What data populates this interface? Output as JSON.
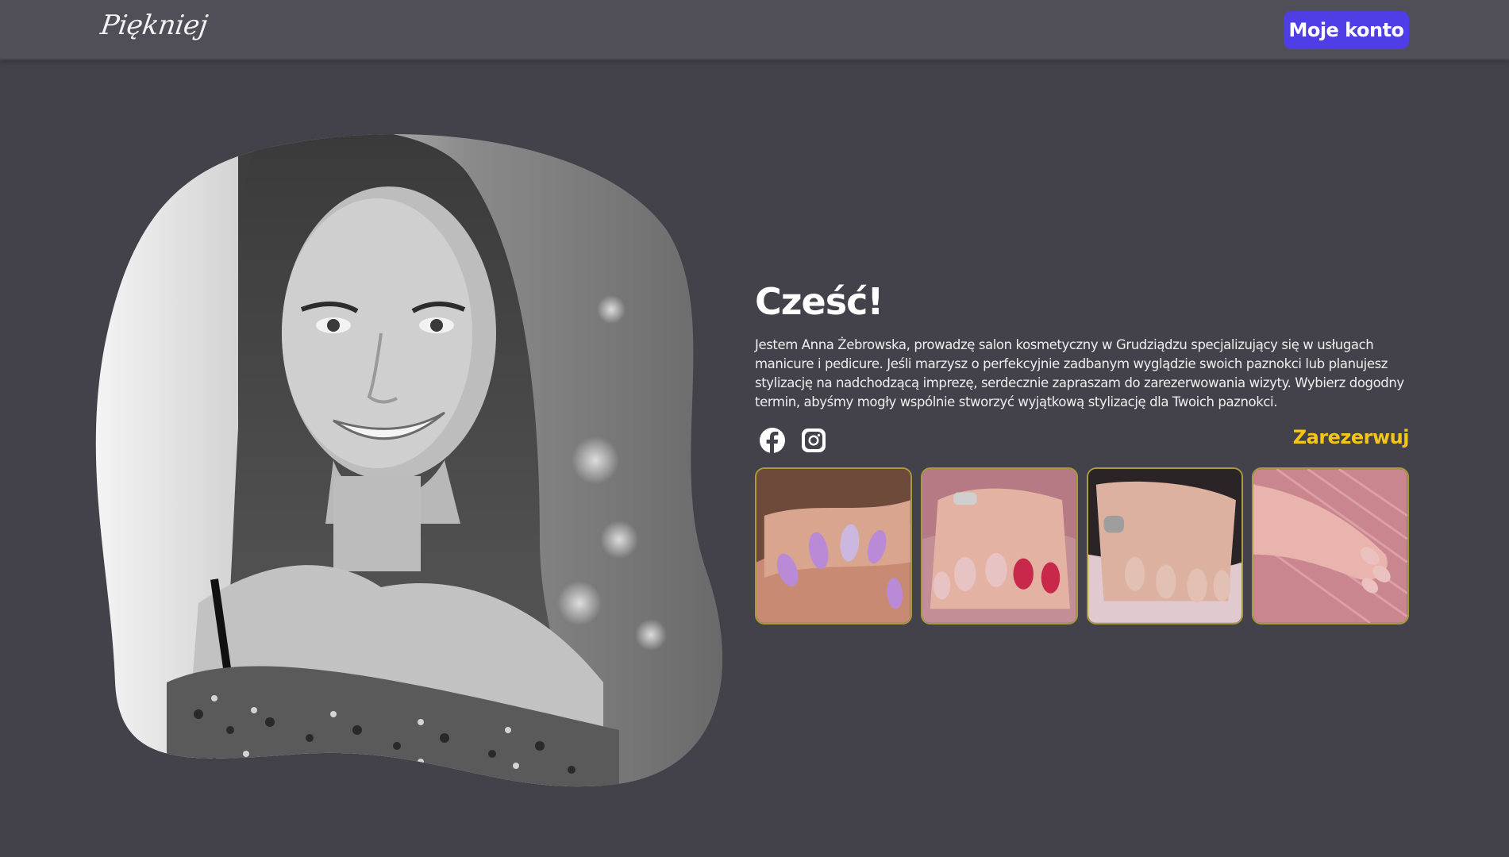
{
  "navbar": {
    "logo": "Piękniej",
    "account_button": "Moje konto"
  },
  "hero": {
    "portrait_alt": "Anna Żebrowska",
    "greeting": "Cześć!",
    "bio": "Jestem Anna Żebrowska, prowadzę salon kosmetyczny w Grudziądzu specjalizujący się w usługach manicure i pedicure. Jeśli marzysz o perfekcyjnie zadbanym wyglądzie swoich paznokci lub planujesz stylizację na nadchodzącą imprezę, serdecznie zapraszam do zarezerwowania wizyty. Wybierz dogodny termin, abyśmy mogły wspólnie stworzyć wyjątkową stylizację dla Twoich paznokci.",
    "reserve_link": "Zarezerwuj"
  },
  "social": {
    "icons": [
      "facebook-icon",
      "instagram-icon"
    ]
  },
  "gallery": {
    "items": [
      {
        "name": "lilac-nails-photo",
        "nail_color": "#b98ad6",
        "skin": "#d9a58f",
        "bg": "#6e4a3a"
      },
      {
        "name": "red-nails-photo",
        "nail_color": "#c8284a",
        "skin": "#e3b2a3",
        "bg": "#c48e96"
      },
      {
        "name": "nude-nails-photo",
        "nail_color": "#e2c0b4",
        "skin": "#dcb19f",
        "bg": "#2a2426"
      },
      {
        "name": "pink-nails-photo",
        "nail_color": "#eac1bf",
        "skin": "#e9b4ad",
        "bg": "#c9868e"
      }
    ]
  },
  "colors": {
    "background": "#434149",
    "navbar": "#504e56",
    "accent": "#4f3ee6",
    "link": "#f5c518"
  }
}
